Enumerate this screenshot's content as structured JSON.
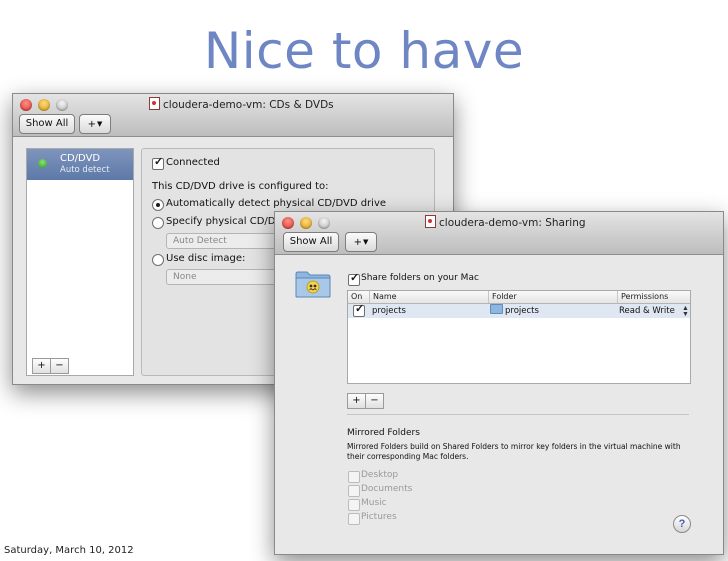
{
  "slide": {
    "title": "Nice to have",
    "footer": "Saturday, March 10, 2012"
  },
  "colors": {
    "title": "#6f86c4",
    "selection": "#6a83b1",
    "window_bg": "#e8e8e8"
  },
  "cd_window": {
    "title": "cloudera-demo-vm: CDs & DVDs",
    "toolbar": {
      "show_all": "Show All",
      "add": "+"
    },
    "sidebar": {
      "item_title": "CD/DVD",
      "item_subtitle": "Auto detect",
      "add": "+",
      "remove": "−"
    },
    "connected_label": "Connected",
    "configured_label": "This CD/DVD drive is configured to:",
    "option_auto": "Automatically detect physical CD/DVD drive",
    "option_specify": "Specify physical CD/DVD",
    "specify_popup": "Auto Detect",
    "option_image": "Use disc image:",
    "image_popup": "None"
  },
  "sharing_window": {
    "title": "cloudera-demo-vm: Sharing",
    "toolbar": {
      "show_all": "Show All",
      "add": "+"
    },
    "share_label": "Share folders on your Mac",
    "table": {
      "headers": [
        "On",
        "Name",
        "Folder",
        "Permissions"
      ],
      "rows": [
        {
          "name": "projects",
          "folder": "projects",
          "permissions": "Read & Write"
        }
      ]
    },
    "add": "+",
    "remove": "−",
    "mirrored_title": "Mirrored Folders",
    "mirrored_desc_1": "Mirrored Folders build on Shared Folders to mirror key folders in the virtual machine with",
    "mirrored_desc_2": "their corresponding Mac folders.",
    "mirrored_items": [
      "Desktop",
      "Documents",
      "Music",
      "Pictures"
    ],
    "help": "?"
  }
}
